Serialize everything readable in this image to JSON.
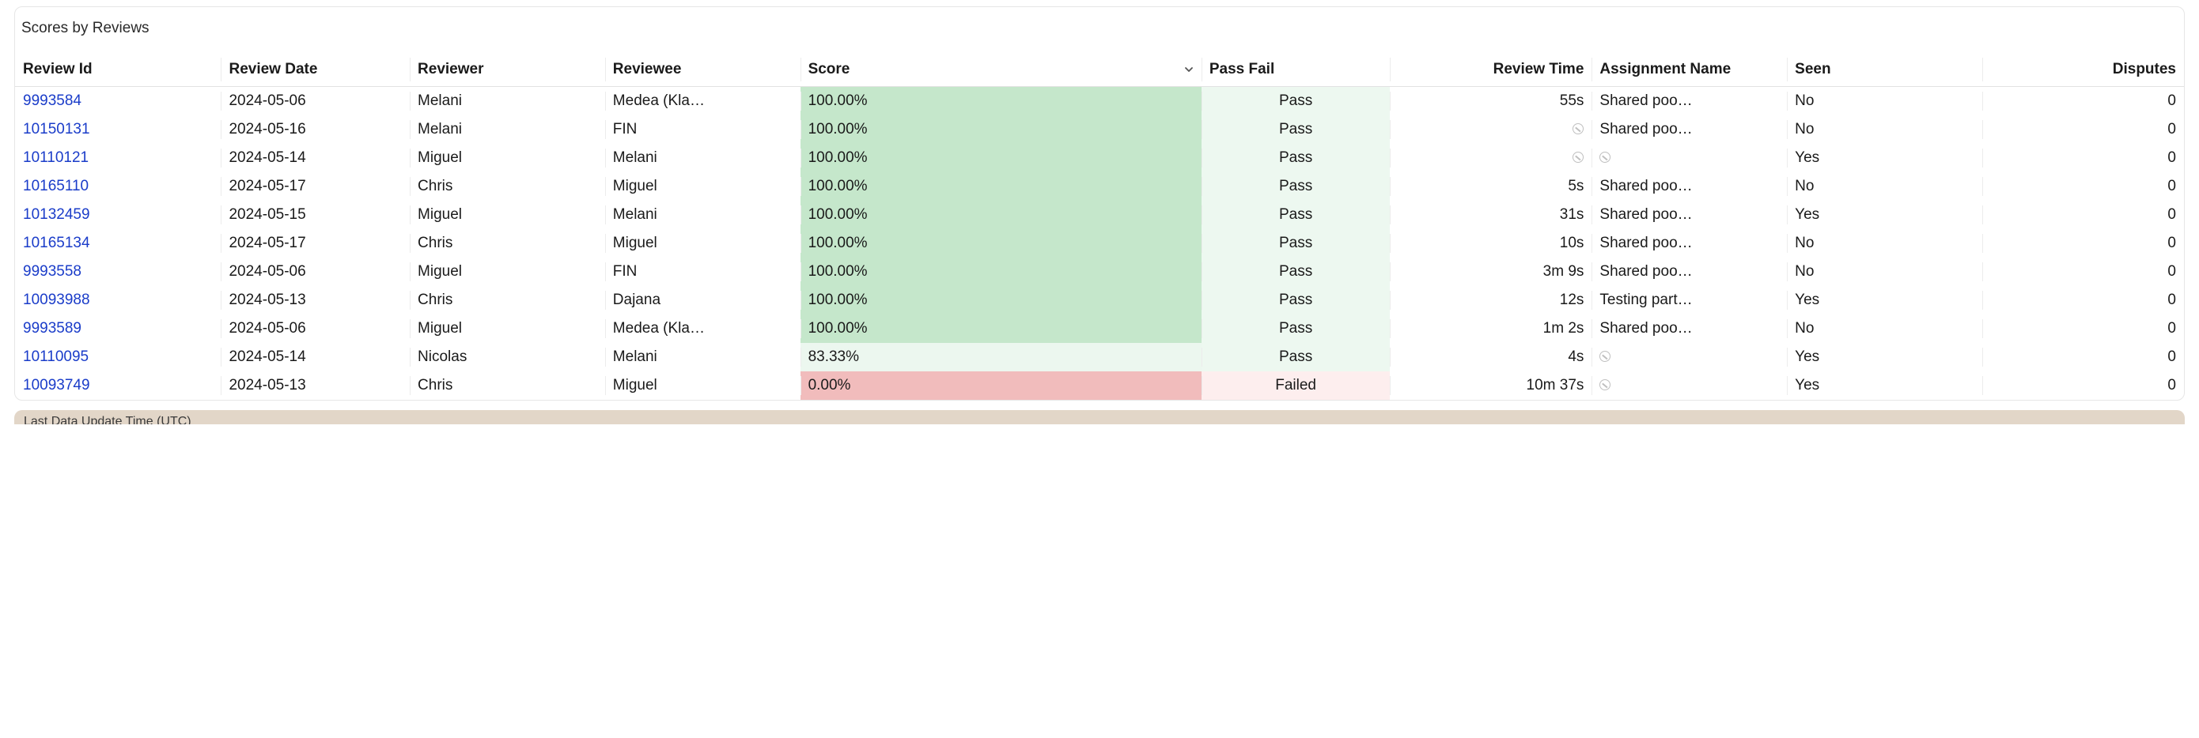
{
  "card_title": "Scores by Reviews",
  "columns": {
    "review_id": "Review Id",
    "review_date": "Review Date",
    "reviewer": "Reviewer",
    "reviewee": "Reviewee",
    "score": "Score",
    "pass_fail": "Pass Fail",
    "review_time": "Review Time",
    "assignment": "Assignment Name",
    "seen": "Seen",
    "disputes": "Disputes"
  },
  "sort_column": "score",
  "sort_dir": "desc",
  "rows": [
    {
      "id": "9993584",
      "date": "2024-05-06",
      "reviewer": "Melani",
      "reviewee": "Medea (Kla…",
      "score": "100.00%",
      "score_bucket": "high",
      "pf": "Pass",
      "time": "55s",
      "asg": "Shared poo…",
      "seen": "No",
      "disputes": "0"
    },
    {
      "id": "10150131",
      "date": "2024-05-16",
      "reviewer": "Melani",
      "reviewee": "FIN",
      "score": "100.00%",
      "score_bucket": "high",
      "pf": "Pass",
      "time": null,
      "asg": "Shared poo…",
      "seen": "No",
      "disputes": "0"
    },
    {
      "id": "10110121",
      "date": "2024-05-14",
      "reviewer": "Miguel",
      "reviewee": "Melani",
      "score": "100.00%",
      "score_bucket": "high",
      "pf": "Pass",
      "time": null,
      "asg": null,
      "seen": "Yes",
      "disputes": "0"
    },
    {
      "id": "10165110",
      "date": "2024-05-17",
      "reviewer": "Chris",
      "reviewee": "Miguel",
      "score": "100.00%",
      "score_bucket": "high",
      "pf": "Pass",
      "time": "5s",
      "asg": "Shared poo…",
      "seen": "No",
      "disputes": "0"
    },
    {
      "id": "10132459",
      "date": "2024-05-15",
      "reviewer": "Miguel",
      "reviewee": "Melani",
      "score": "100.00%",
      "score_bucket": "high",
      "pf": "Pass",
      "time": "31s",
      "asg": "Shared poo…",
      "seen": "Yes",
      "disputes": "0"
    },
    {
      "id": "10165134",
      "date": "2024-05-17",
      "reviewer": "Chris",
      "reviewee": "Miguel",
      "score": "100.00%",
      "score_bucket": "high",
      "pf": "Pass",
      "time": "10s",
      "asg": "Shared poo…",
      "seen": "No",
      "disputes": "0"
    },
    {
      "id": "9993558",
      "date": "2024-05-06",
      "reviewer": "Miguel",
      "reviewee": "FIN",
      "score": "100.00%",
      "score_bucket": "high",
      "pf": "Pass",
      "time": "3m 9s",
      "asg": "Shared poo…",
      "seen": "No",
      "disputes": "0"
    },
    {
      "id": "10093988",
      "date": "2024-05-13",
      "reviewer": "Chris",
      "reviewee": "Dajana",
      "score": "100.00%",
      "score_bucket": "high",
      "pf": "Pass",
      "time": "12s",
      "asg": "Testing part…",
      "seen": "Yes",
      "disputes": "0"
    },
    {
      "id": "9993589",
      "date": "2024-05-06",
      "reviewer": "Miguel",
      "reviewee": "Medea (Kla…",
      "score": "100.00%",
      "score_bucket": "high",
      "pf": "Pass",
      "time": "1m 2s",
      "asg": "Shared poo…",
      "seen": "No",
      "disputes": "0"
    },
    {
      "id": "10110095",
      "date": "2024-05-14",
      "reviewer": "Nicolas",
      "reviewee": "Melani",
      "score": "83.33%",
      "score_bucket": "mid",
      "pf": "Pass",
      "time": "4s",
      "asg": null,
      "seen": "Yes",
      "disputes": "0"
    },
    {
      "id": "10093749",
      "date": "2024-05-13",
      "reviewer": "Chris",
      "reviewee": "Miguel",
      "score": "0.00%",
      "score_bucket": "low",
      "pf": "Failed",
      "time": "10m 37s",
      "asg": null,
      "seen": "Yes",
      "disputes": "0"
    }
  ],
  "footer_label": "Last Data Update Time (UTC)"
}
